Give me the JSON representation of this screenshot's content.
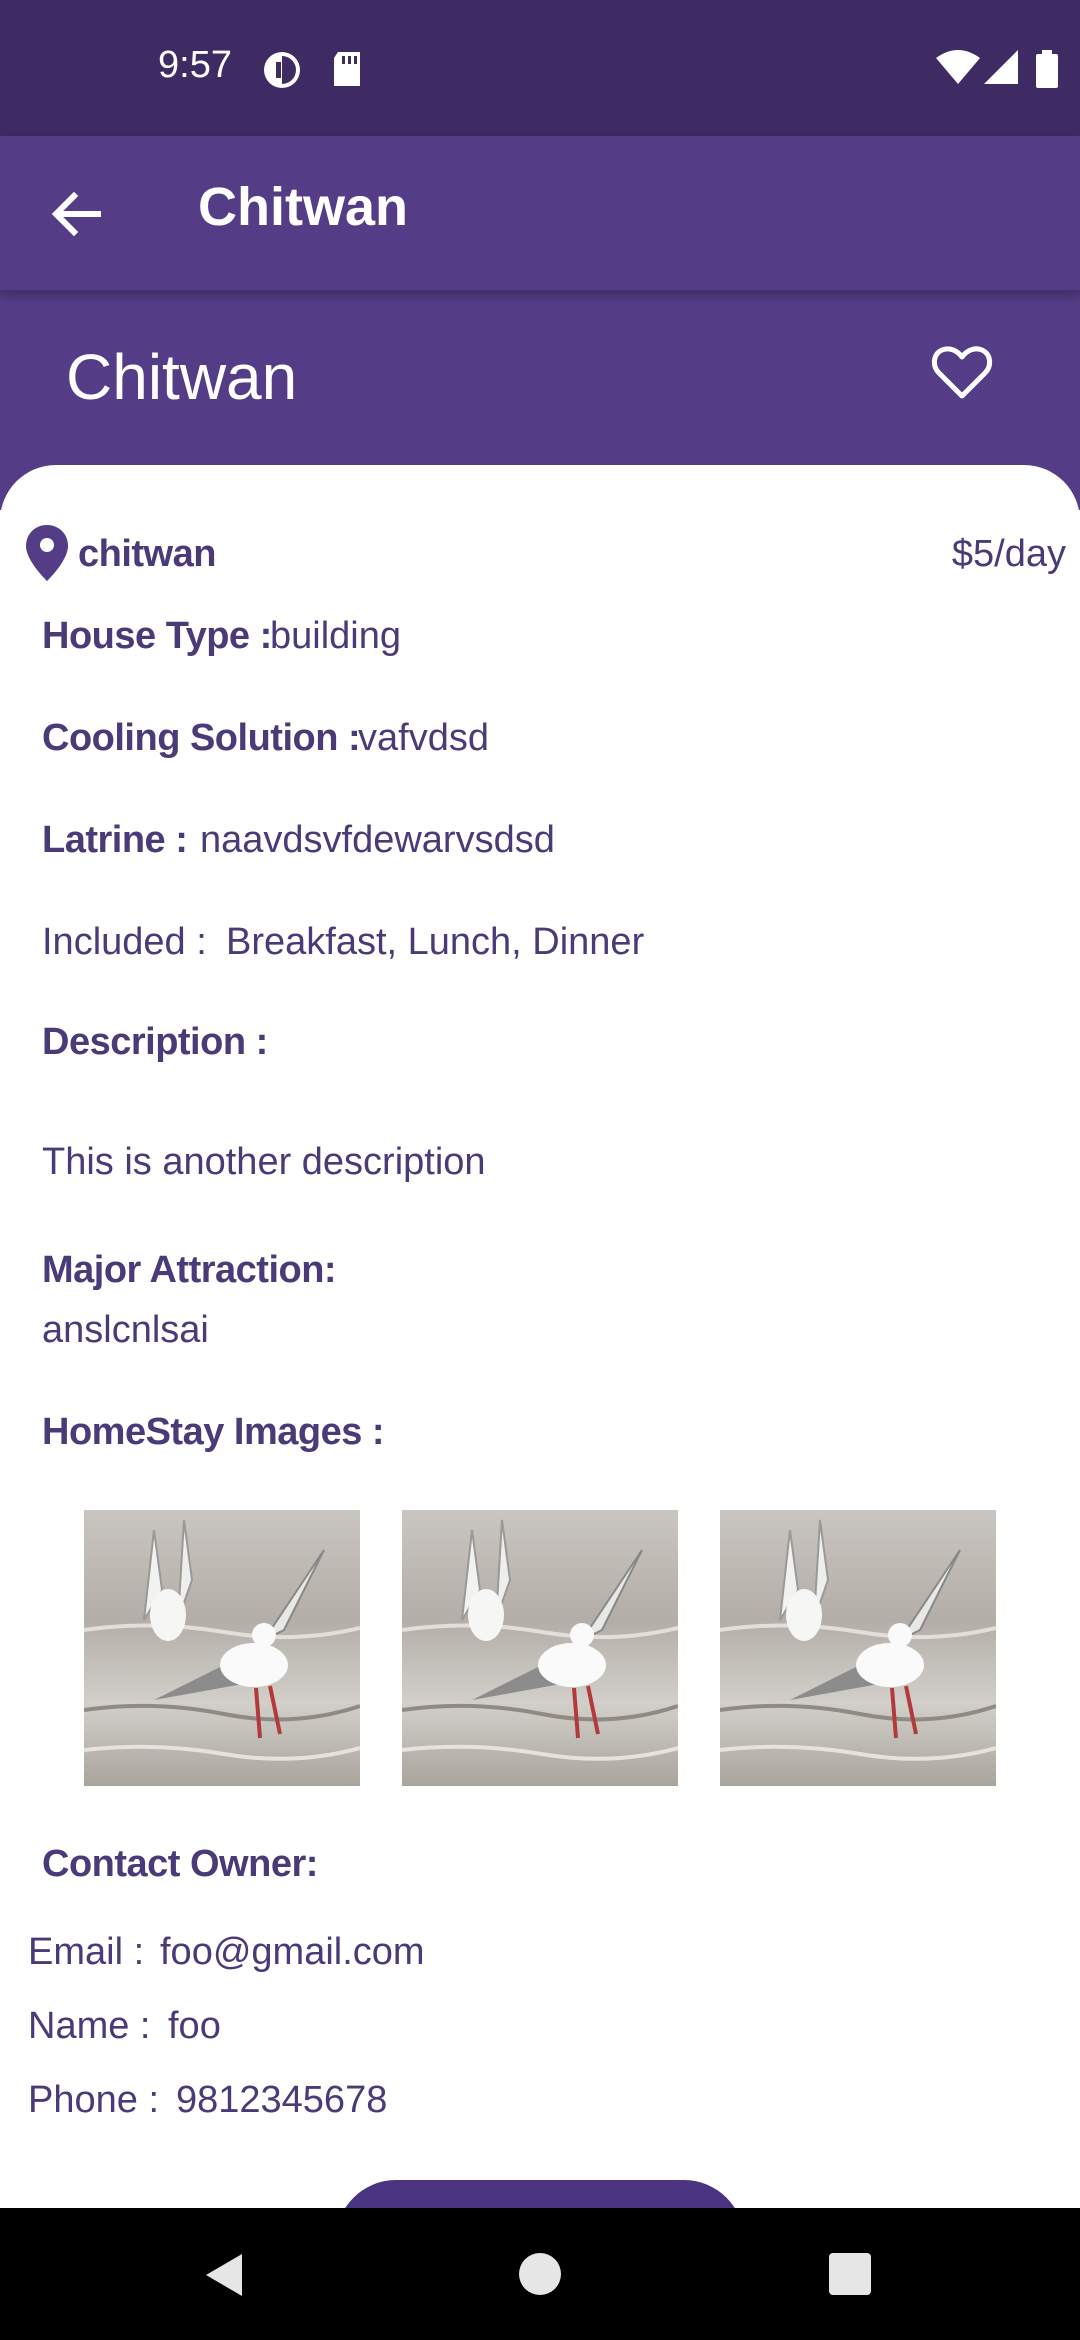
{
  "status_bar": {
    "time": "9:57",
    "icons": [
      "data-saver-icon",
      "sd-card-icon",
      "wifi-icon",
      "signal-icon",
      "battery-icon"
    ]
  },
  "app_bar": {
    "title": "Chitwan",
    "back_icon": "arrow-left-icon"
  },
  "header": {
    "title": "Chitwan",
    "favorite_icon": "heart-outline-icon"
  },
  "details": {
    "location": "chitwan",
    "price": "$5/day",
    "house_type_label": "House Type :",
    "house_type_value": "building",
    "cooling_label": "Cooling Solution :",
    "cooling_value": "vafvdsd",
    "latrine_label": "Latrine :",
    "latrine_value": "naavdsvfdewarvsdsd",
    "included_label": "Included :",
    "included_value": "Breakfast, Lunch, Dinner",
    "description_label": "Description :",
    "description_value": "This is another description",
    "attraction_label": "Major Attraction:",
    "attraction_value": "anslcnlsai",
    "images_label": "HomeStay Images :"
  },
  "contact": {
    "heading": "Contact Owner:",
    "email_label": "Email :",
    "email_value": "foo@gmail.com",
    "name_label": "Name :",
    "name_value": "foo",
    "phone_label": "Phone :",
    "phone_value": "9812345678"
  },
  "colors": {
    "status_bar": "#3f2b63",
    "primary": "#543d86",
    "text": "#4a3a78"
  }
}
